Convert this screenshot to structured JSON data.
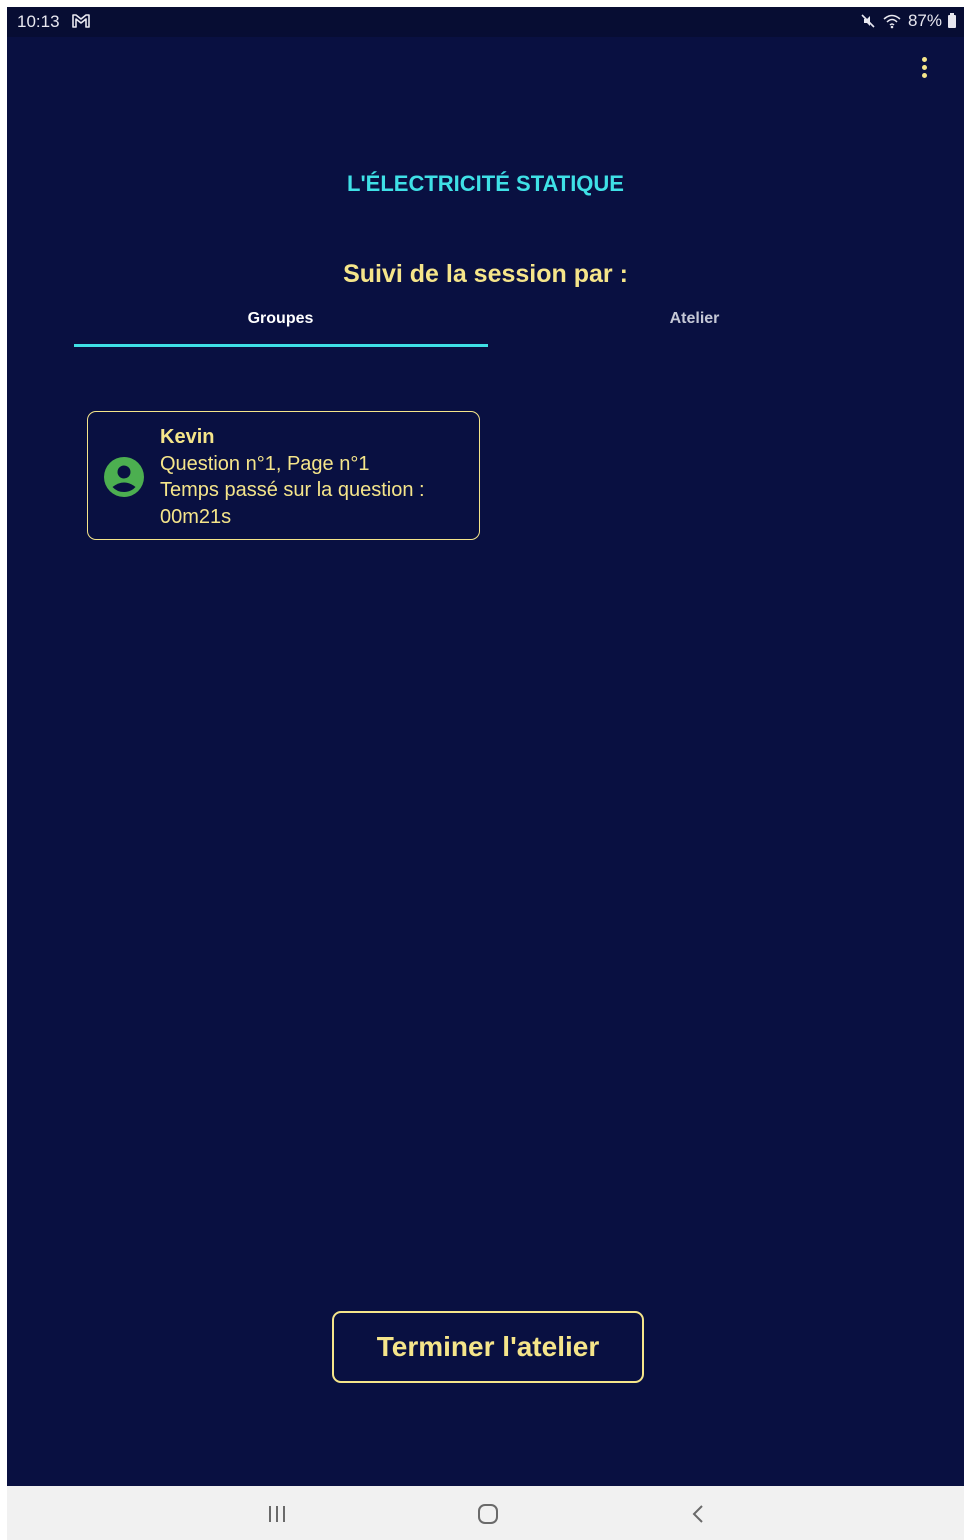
{
  "status_bar": {
    "time": "10:13",
    "battery": "87%",
    "icons": [
      "gmail-icon",
      "mute-icon",
      "wifi-icon",
      "battery-icon"
    ]
  },
  "header": {
    "title": "L'ÉLECTRICITÉ STATIQUE",
    "subtitle": "Suivi de la session par :"
  },
  "tabs": [
    {
      "label": "Groupes",
      "selected": true
    },
    {
      "label": "Atelier",
      "selected": false
    }
  ],
  "groups": [
    {
      "name": "Kevin",
      "question": "Question n°1, Page n°1",
      "time_label": "Temps passé sur la question :",
      "time_value": "00m21s",
      "icon": "account-circle-icon"
    }
  ],
  "actions": {
    "finish_label": "Terminer l'atelier"
  },
  "colors": {
    "background": "#091041",
    "accent_cyan": "#3fe0e6",
    "accent_yellow": "#f5e58a",
    "avatar_green": "#4caf50"
  }
}
